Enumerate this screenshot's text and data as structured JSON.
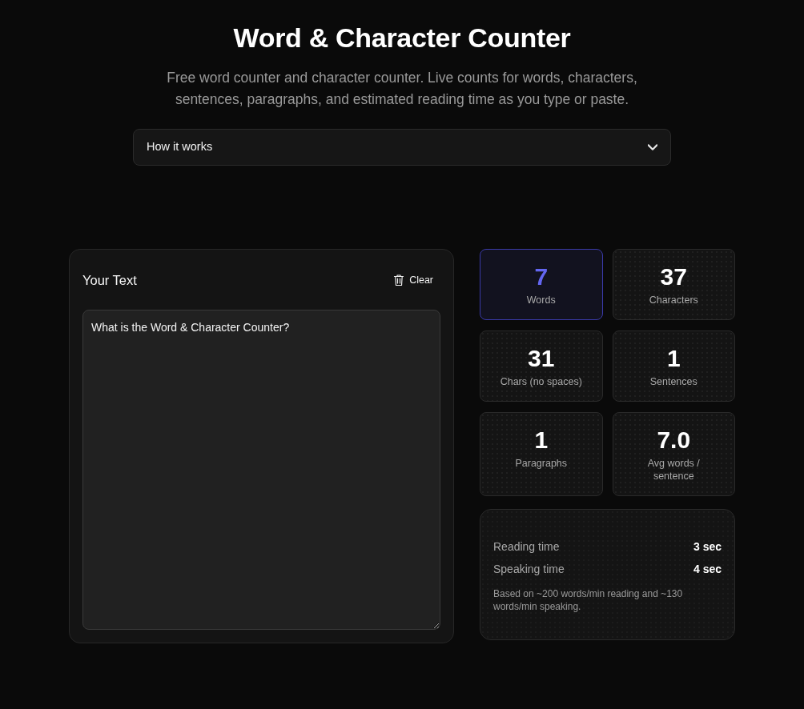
{
  "header": {
    "title": "Word & Character Counter",
    "subtitle": "Free word counter and character counter. Live counts for words, characters, sentences, paragraphs, and estimated reading time as you type or paste."
  },
  "accordion": {
    "label": "How it works",
    "expanded": false
  },
  "editor": {
    "title": "Your Text",
    "clear_button": "Clear",
    "value": "What is the Word & Character Counter?"
  },
  "stats": [
    {
      "value": "7",
      "label": "Words",
      "highlighted": true
    },
    {
      "value": "37",
      "label": "Characters",
      "highlighted": false
    },
    {
      "value": "31",
      "label": "Chars (no spaces)",
      "highlighted": false
    },
    {
      "value": "1",
      "label": "Sentences",
      "highlighted": false
    },
    {
      "value": "1",
      "label": "Paragraphs",
      "highlighted": false
    },
    {
      "value": "7.0",
      "label": "Avg words / sentence",
      "highlighted": false
    }
  ],
  "timing": {
    "rows": [
      {
        "label": "Reading time",
        "value": "3 sec"
      },
      {
        "label": "Speaking time",
        "value": "4 sec"
      }
    ],
    "note": "Based on ~200 words/min reading and ~130 words/min speaking."
  }
}
